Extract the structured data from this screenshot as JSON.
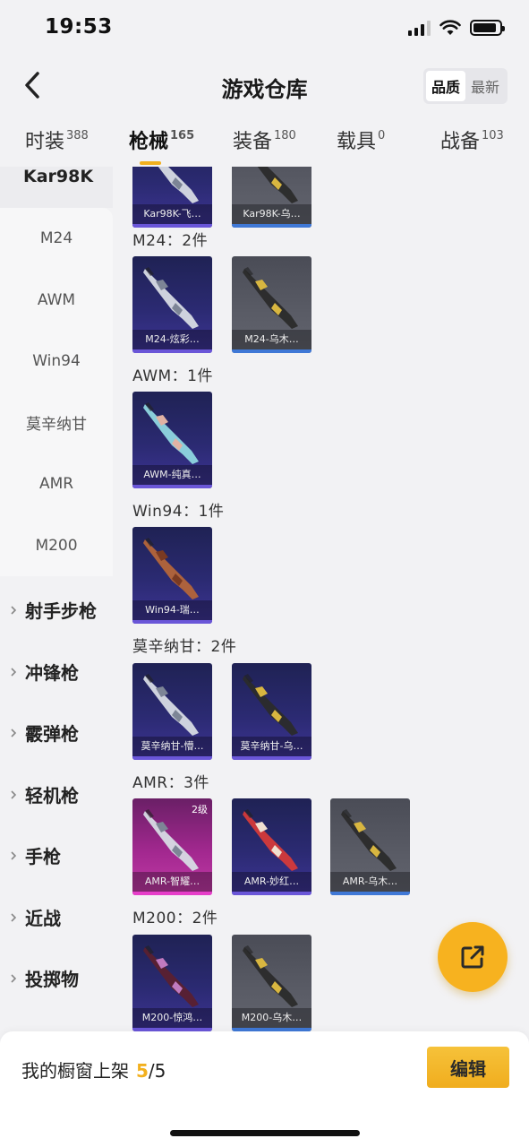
{
  "status": {
    "time": "19:53"
  },
  "header": {
    "title": "游戏仓库",
    "sort_options": [
      "品质",
      "最新"
    ],
    "sort_active": "品质"
  },
  "tabs": [
    {
      "label": "时装",
      "count": "388"
    },
    {
      "label": "枪械",
      "count": "165"
    },
    {
      "label": "装备",
      "count": "180"
    },
    {
      "label": "载具",
      "count": "0"
    },
    {
      "label": "战备",
      "count": "103"
    }
  ],
  "sidebar": {
    "current": "Kar98K",
    "items": [
      "M24",
      "AWM",
      "Win94",
      "莫辛纳甘",
      "AMR",
      "M200"
    ],
    "groups": [
      "射手步枪",
      "冲锋枪",
      "霰弹枪",
      "轻机枪",
      "手枪",
      "近战",
      "投掷物"
    ]
  },
  "sections": [
    {
      "label": "",
      "items": [
        {
          "name": "Kar98K-飞…",
          "rarity": "purple",
          "gun": "silver"
        },
        {
          "name": "Kar98K-乌…",
          "rarity": "grey",
          "gun": "gold"
        }
      ]
    },
    {
      "label": "M24：2件",
      "items": [
        {
          "name": "M24-炫彩…",
          "rarity": "purple",
          "gun": "silver"
        },
        {
          "name": "M24-乌木…",
          "rarity": "grey",
          "gun": "gold"
        }
      ]
    },
    {
      "label": "AWM：1件",
      "items": [
        {
          "name": "AWM-纯真…",
          "rarity": "purple",
          "gun": "cyan"
        }
      ]
    },
    {
      "label": "Win94：1件",
      "items": [
        {
          "name": "Win94-瑞…",
          "rarity": "purple",
          "gun": "wood"
        }
      ]
    },
    {
      "label": "莫辛纳甘：2件",
      "items": [
        {
          "name": "莫辛纳甘-懵…",
          "rarity": "purple",
          "gun": "silver"
        },
        {
          "name": "莫辛纳甘-乌…",
          "rarity": "purple",
          "gun": "gold"
        }
      ]
    },
    {
      "label": "AMR：3件",
      "items": [
        {
          "name": "AMR-智耀…",
          "rarity": "pink",
          "gun": "silver",
          "level": "2级"
        },
        {
          "name": "AMR-妙红…",
          "rarity": "purple",
          "gun": "red"
        },
        {
          "name": "AMR-乌木…",
          "rarity": "grey",
          "gun": "gold"
        }
      ]
    },
    {
      "label": "M200：2件",
      "items": [
        {
          "name": "M200-惊鸿…",
          "rarity": "purple",
          "gun": "maroon"
        },
        {
          "name": "M200-乌木…",
          "rarity": "grey",
          "gun": "gold"
        }
      ]
    }
  ],
  "bottom": {
    "label": "我的橱窗上架",
    "current": "5",
    "sep": "/",
    "total": "5",
    "edit": "编辑"
  },
  "colors": {
    "accent": "#f2b01e",
    "purple_bar": "#6a56d8",
    "grey_bar": "#3f78d6",
    "pink_bar": "#e63ec9"
  },
  "icons": {
    "back": "chevron-left-icon",
    "share": "share-external-icon",
    "group": "chevron-right-icon"
  }
}
